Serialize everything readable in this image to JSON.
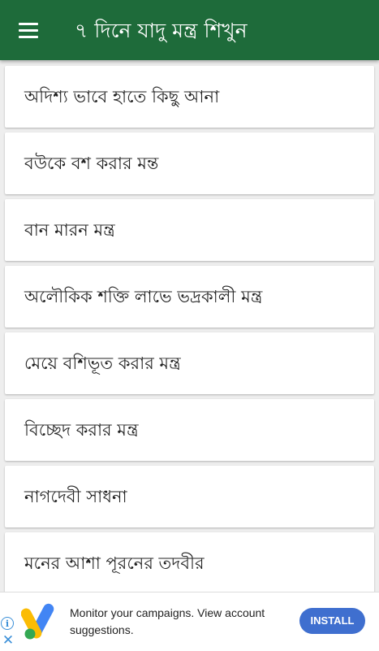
{
  "appbar": {
    "title": "৭ দিনে যাদু মন্ত্র শিখুন",
    "menu_icon": "hamburger-menu-icon"
  },
  "list": {
    "items": [
      {
        "label": "অদিশ্য ভাবে হাতে কিছু আনা"
      },
      {
        "label": "বউকে বশ করার মন্ত"
      },
      {
        "label": "বান মারন মন্ত্র"
      },
      {
        "label": "অলৌকিক শক্তি লাভে ভদ্রকালী মন্ত্র"
      },
      {
        "label": "মেয়ে বশিভূত করার মন্ত্র"
      },
      {
        "label": "বিচ্ছেদ করার মন্ত্র"
      },
      {
        "label": "নাগদেবী সাধনা"
      },
      {
        "label": "মনের আশা পূরনের তদবীর"
      }
    ]
  },
  "ad": {
    "text": "Monitor your campaigns. View account suggestions.",
    "button_label": "INSTALL",
    "info_glyph": "i",
    "close_glyph": "✕"
  },
  "colors": {
    "appbar": "#1e6b3a",
    "install_button": "#3f6fcf",
    "ad_icon": "#3a8fd8"
  }
}
